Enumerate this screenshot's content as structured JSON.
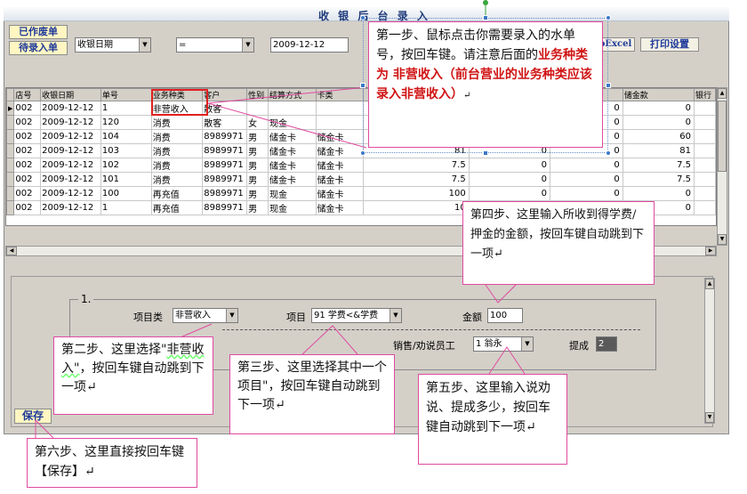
{
  "window": {
    "title": "收 银 后 台 录 入"
  },
  "toolbar": {
    "voided_button": "已作废单",
    "pending_button": "待录入单",
    "filter_field": "收银日期",
    "filter_operator": "=",
    "filter_value": "2009-12-12",
    "excel_button": "oExcel",
    "print_settings_button": "打印设置"
  },
  "grid": {
    "columns": [
      "店号",
      "收银日期",
      "单号",
      "业务种类",
      "客户",
      "性别",
      "结算方式",
      "卡类",
      "",
      "",
      "",
      "储金款",
      "银行"
    ],
    "rows": [
      [
        "002",
        "2009-12-12",
        "1",
        "非营收入",
        "散客",
        "",
        "",
        "",
        "",
        "",
        "0",
        "0",
        ""
      ],
      [
        "002",
        "2009-12-12",
        "120",
        "消费",
        "散客",
        "女",
        "现金",
        "",
        "",
        "",
        "0",
        "0",
        ""
      ],
      [
        "002",
        "2009-12-12",
        "104",
        "消费",
        "8989971",
        "男",
        "储金卡",
        "储金卡",
        "",
        "",
        "0",
        "60",
        ""
      ],
      [
        "002",
        "2009-12-12",
        "103",
        "消费",
        "8989971",
        "男",
        "储金卡",
        "储金卡",
        "81",
        "0",
        "0",
        "81",
        ""
      ],
      [
        "002",
        "2009-12-12",
        "102",
        "消费",
        "8989971",
        "男",
        "储金卡",
        "储金卡",
        "7.5",
        "0",
        "0",
        "7.5",
        ""
      ],
      [
        "002",
        "2009-12-12",
        "101",
        "消费",
        "8989971",
        "男",
        "储金卡",
        "储金卡",
        "7.5",
        "0",
        "0",
        "7.5",
        ""
      ],
      [
        "002",
        "2009-12-12",
        "100",
        "再充值",
        "8989971",
        "男",
        "现金",
        "储金卡",
        "100",
        "0",
        "0",
        "0",
        ""
      ],
      [
        "002",
        "2009-12-12",
        "1",
        "再充值",
        "8989971",
        "男",
        "现金",
        "储金卡",
        "10",
        "",
        "",
        "0",
        ""
      ]
    ]
  },
  "form": {
    "group_label": "1.",
    "item_type_label": "项目类",
    "item_type_value": "非营收入",
    "item_label": "项目",
    "item_value": "91  学费<&学费",
    "amount_label": "金额",
    "amount_value": "100",
    "staff_label": "销售/劝说员工",
    "staff_value": "1  翁永",
    "commission_label": "提成",
    "commission_value": "2",
    "save_button": "保存"
  },
  "callouts": {
    "step1_prefix": "第一步、鼠标点击你需要录入的水单号，按回车键。请注意后面的",
    "step1_highlight": "业务种类为 非营收入（前台营业的业务种类应该录入非营收入）",
    "step1_end": "↵",
    "step2_a": "第二步、这里选择\"",
    "step2_b": "非营收入\"",
    "step2_c": "，按回车键自动跳到下一项↵",
    "step3": "第三步、这里选择其中一个项目\"，按回车键自动跳到下一项↵",
    "step4": "第四步、这里输入所收到得学费/押金的金额，按回车键自动跳到下一项↵",
    "step5": "第五步、这里输入说劝说、提成多少，按回车键自动跳到下一项↵",
    "step6": "第六步、这里直接按回车键【保存】↵"
  },
  "colors": {
    "callout_border": "#e04aa0",
    "highlight_red": "#d01414",
    "window_gray": "#d4d0c8",
    "button_text_blue": "#1f3a9a"
  }
}
